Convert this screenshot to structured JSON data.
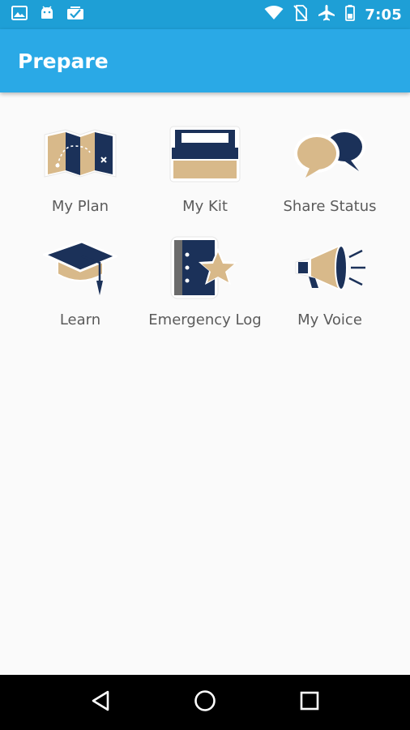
{
  "status_bar": {
    "time": "7:05",
    "left_icons": [
      "image-icon",
      "android-icon",
      "inbox-check-icon"
    ],
    "right_icons": [
      "wifi-icon",
      "no-sim-icon",
      "airplane-mode-icon",
      "battery-icon"
    ]
  },
  "app_bar": {
    "title": "Prepare"
  },
  "tiles": [
    {
      "label": "My Plan",
      "icon": "map-icon"
    },
    {
      "label": "My Kit",
      "icon": "kit-box-icon"
    },
    {
      "label": "Share Status",
      "icon": "speech-bubbles-icon"
    },
    {
      "label": "Learn",
      "icon": "graduation-cap-icon"
    },
    {
      "label": "Emergency Log",
      "icon": "log-book-star-icon"
    },
    {
      "label": "My Voice",
      "icon": "megaphone-icon"
    }
  ],
  "nav_bar": {
    "buttons": [
      "back-icon",
      "home-icon",
      "recents-icon"
    ]
  },
  "colors": {
    "status_bar": "#1e9fd6",
    "app_bar": "#2aa9e6",
    "navy": "#1b3159",
    "tan": "#d8b98a",
    "background": "#fafafa"
  }
}
